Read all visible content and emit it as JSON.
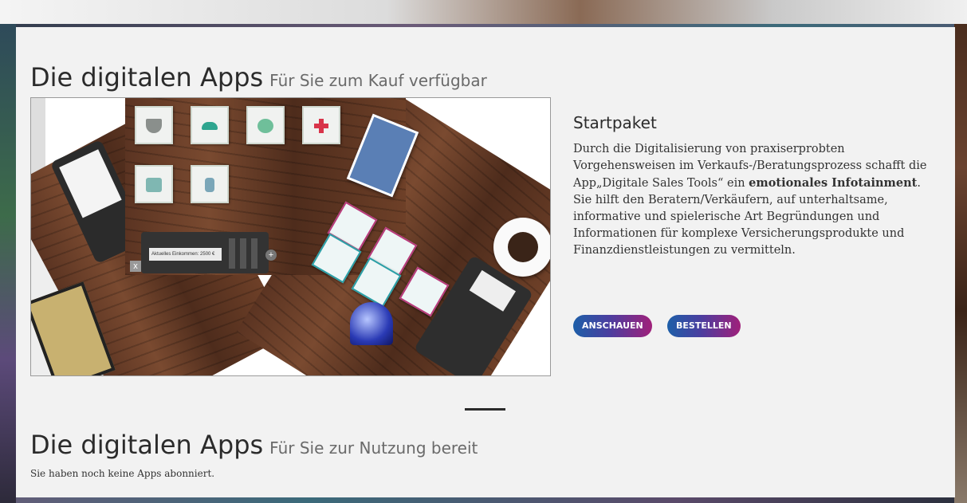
{
  "section_purchase": {
    "title": "Die digitalen Apps",
    "subtitle": "Für Sie zum Kauf verfügbar"
  },
  "app": {
    "name": "Startpaket",
    "description_parts": {
      "p1": "Durch die Digitalisierung von praxiserprobten Vorgehensweisen im Verkaufs-/Beratungsprozess schafft die App„Digitale Sales Tools“ ein ",
      "b1": "emotionales Infotainment",
      "p2": ". Sie hilft den Beratern/Verkäufern, auf unterhaltsame, informative und spielerische Art Begründungen und Informationen für komplexe Versicherungsprodukte und Finanzdienstleistungen zu vermitteln."
    },
    "buttons": {
      "view": "ANSCHAUEN",
      "order": "BESTELLEN"
    },
    "preview": {
      "calc_field": "Aktuelles Einkommen:   2500 €",
      "close_symbol": "x",
      "expand_symbol": "+"
    }
  },
  "section_subscribed": {
    "title": "Die digitalen Apps",
    "subtitle": "Für Sie zur Nutzung bereit",
    "empty_message": "Sie haben noch keine Apps abonniert."
  },
  "colors": {
    "panel": "#f2f2f2",
    "button_gradient_start": "#1d5fa8",
    "button_gradient_end": "#a0207a",
    "text": "#2b2b2b"
  },
  "icons": [
    "shield-icon",
    "car-icon",
    "globe-icon",
    "medical-cross-icon",
    "luggage-icon",
    "bottle-icon"
  ]
}
